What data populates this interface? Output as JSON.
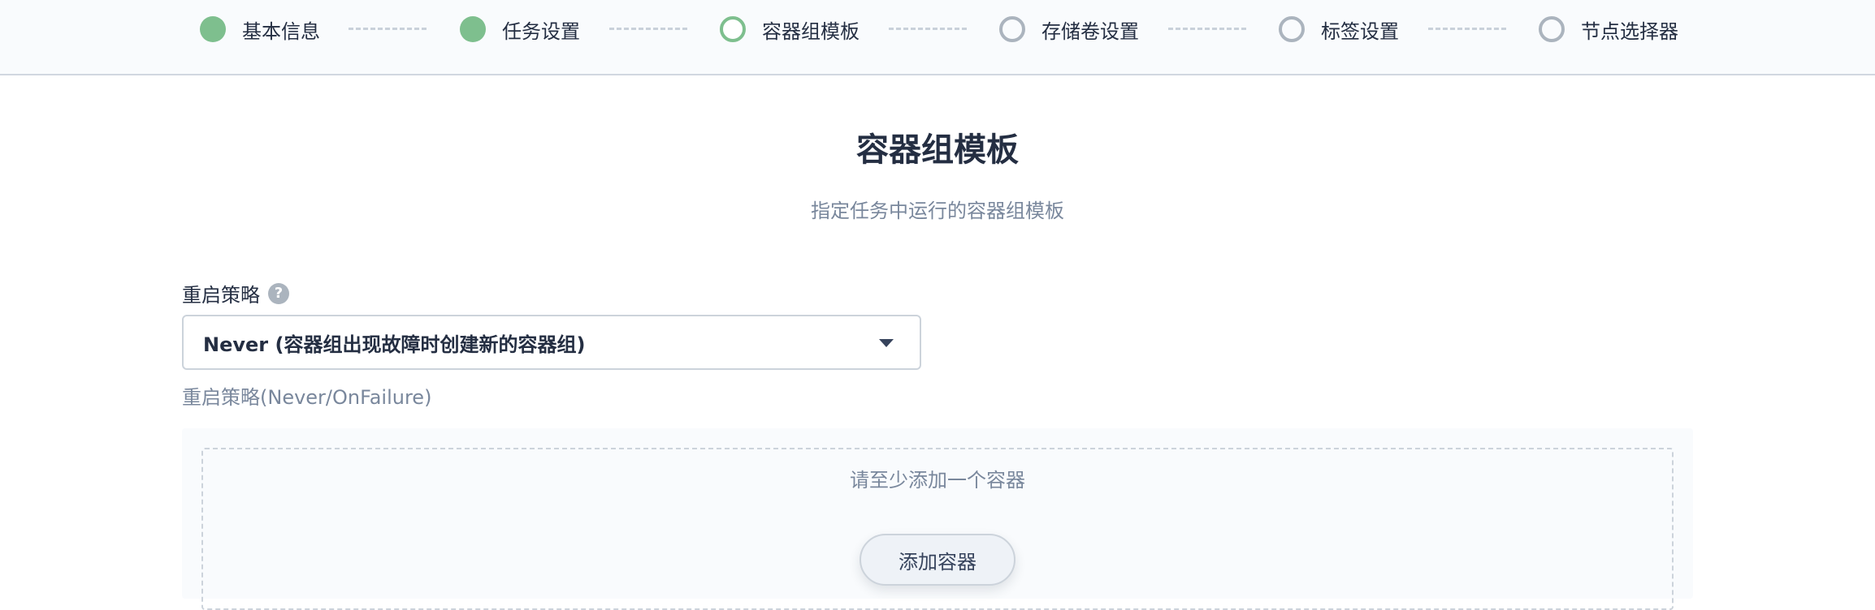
{
  "steps": [
    {
      "label": "基本信息",
      "state": "done"
    },
    {
      "label": "任务设置",
      "state": "done"
    },
    {
      "label": "容器组模板",
      "state": "active"
    },
    {
      "label": "存储卷设置",
      "state": "pending"
    },
    {
      "label": "标签设置",
      "state": "pending"
    },
    {
      "label": "节点选择器",
      "state": "pending"
    }
  ],
  "page": {
    "title": "容器组模板",
    "subtitle": "指定任务中运行的容器组模板"
  },
  "restart_policy": {
    "label": "重启策略",
    "help": "?",
    "value": "Never (容器组出现故障时创建新的容器组)",
    "description": "重启策略(Never/OnFailure)"
  },
  "containers": {
    "empty_text": "请至少添加一个容器",
    "add_label": "添加容器"
  },
  "colors": {
    "done": "#7ebf8e",
    "pending": "#abb4be"
  }
}
